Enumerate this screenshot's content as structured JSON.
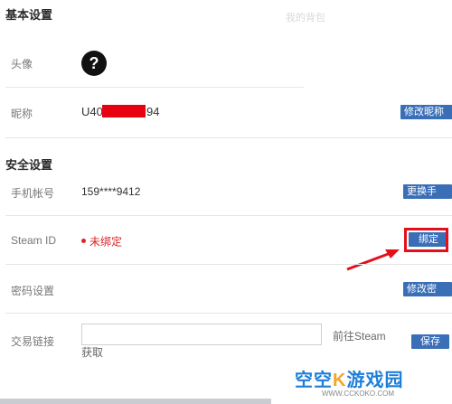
{
  "basic": {
    "section_title": "基本设置",
    "faint_tab": "我的背包",
    "avatar_label": "头像",
    "avatar_glyph": "?",
    "nickname_label": "昵称",
    "nickname_prefix": "U40",
    "nickname_suffix": "94",
    "edit_nickname_btn": "修改昵称"
  },
  "security": {
    "section_title": "安全设置",
    "phone_label": "手机帐号",
    "phone_value": "159****9412",
    "change_phone_btn": "更换手",
    "steam_label": "Steam ID",
    "steam_status": "未绑定",
    "bind_btn": "绑定",
    "password_label": "密码设置",
    "edit_password_btn": "修改密",
    "trade_label": "交易链接",
    "trade_input_value": "",
    "goto_steam_text": "前往Steam",
    "fetch_text": "获取",
    "save_btn": "保存"
  },
  "watermark": {
    "text": "空空",
    "text2": "游戏园",
    "url": "WWW.CCKOKO.COM"
  },
  "colors": {
    "button_blue": "#3a6fb7",
    "status_red": "#d8262a",
    "highlight_red": "#e3101b",
    "watermark_blue": "#1f7fd8"
  }
}
